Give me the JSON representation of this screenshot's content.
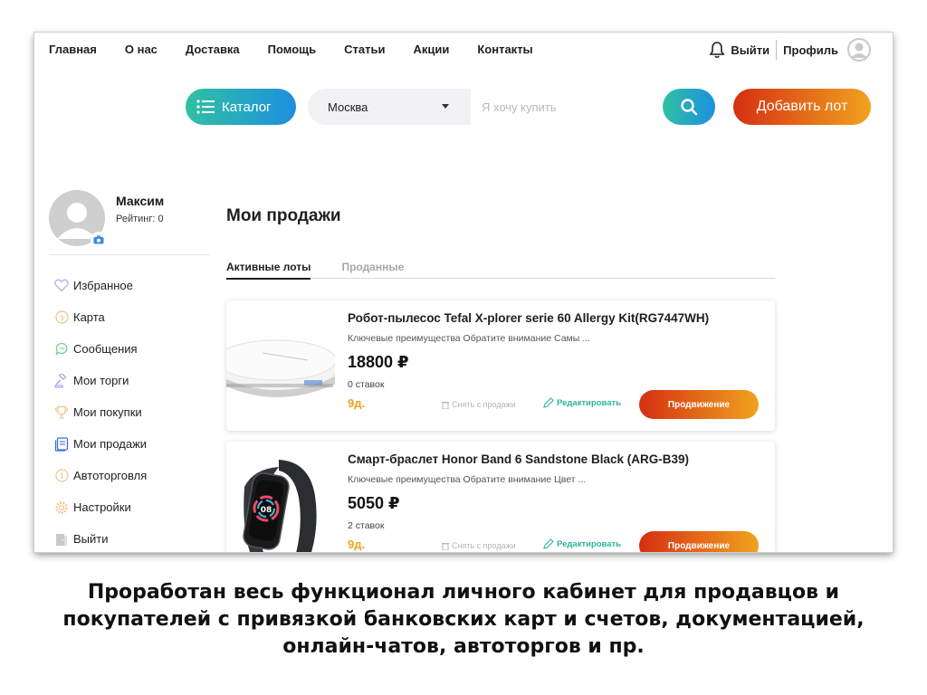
{
  "nav": {
    "items": [
      "Главная",
      "О нас",
      "Доставка",
      "Помощь",
      "Статьи",
      "Акции",
      "Контакты"
    ],
    "logout": "Выйти",
    "profile": "Профиль"
  },
  "search": {
    "catalog_label": "Каталог",
    "city": "Москва",
    "placeholder": "Я хочу купить",
    "add_lot": "Добавить лот"
  },
  "profile": {
    "name": "Максим",
    "rating": "Рейтинг: 0"
  },
  "sidebar": {
    "items": [
      {
        "label": "Избранное",
        "icon": "heart-icon"
      },
      {
        "label": "Карта",
        "icon": "coin-icon"
      },
      {
        "label": "Сообщения",
        "icon": "chat-icon"
      },
      {
        "label": "Мои торги",
        "icon": "gavel-icon"
      },
      {
        "label": "Мои покупки",
        "icon": "trophy-icon"
      },
      {
        "label": "Мои продажи",
        "icon": "document-icon"
      },
      {
        "label": "Автоторговля",
        "icon": "info-icon"
      },
      {
        "label": "Настройки",
        "icon": "gear-icon"
      },
      {
        "label": "Выйти",
        "icon": "exit-door-icon"
      }
    ]
  },
  "main": {
    "title": "Мои продажи",
    "tabs": [
      "Активные лоты",
      "Проданные"
    ],
    "lots": [
      {
        "title": "Робот-пылесос Tefal X-plorer serie 60 Allergy Kit(RG7447WH)",
        "desc": "Ключевые преимущества Обратите внимание Самы ...",
        "price": "18800 ₽",
        "bids": "0 ставок",
        "days": "9д.",
        "remove": "Снять с продажи",
        "edit": "Редактировать",
        "promo": "Продвижение",
        "image": "robot-vacuum"
      },
      {
        "title": "Смарт-браслет Honor Band 6 Sandstone Black (ARG-B39)",
        "desc": "Ключевые преимущества Обратите внимание Цвет ...",
        "price": "5050 ₽",
        "bids": "2 ставок",
        "days": "9д.",
        "remove": "Снять с продажи",
        "edit": "Редактировать",
        "promo": "Продвижение",
        "image": "smart-band"
      }
    ]
  },
  "caption": {
    "line1": "Проработан весь функционал личного кабинет для продавцов и",
    "line2": "покупателей с привязкой банковских карт и счетов, документацией,",
    "line3": "онлайн-чатов, автоторгов и пр."
  },
  "colors": {
    "accent_gradient_start": "#2fc1a2",
    "accent_gradient_end": "#1e8fe0",
    "promo_gradient_start": "#d62f12",
    "promo_gradient_end": "#f0a31f"
  }
}
